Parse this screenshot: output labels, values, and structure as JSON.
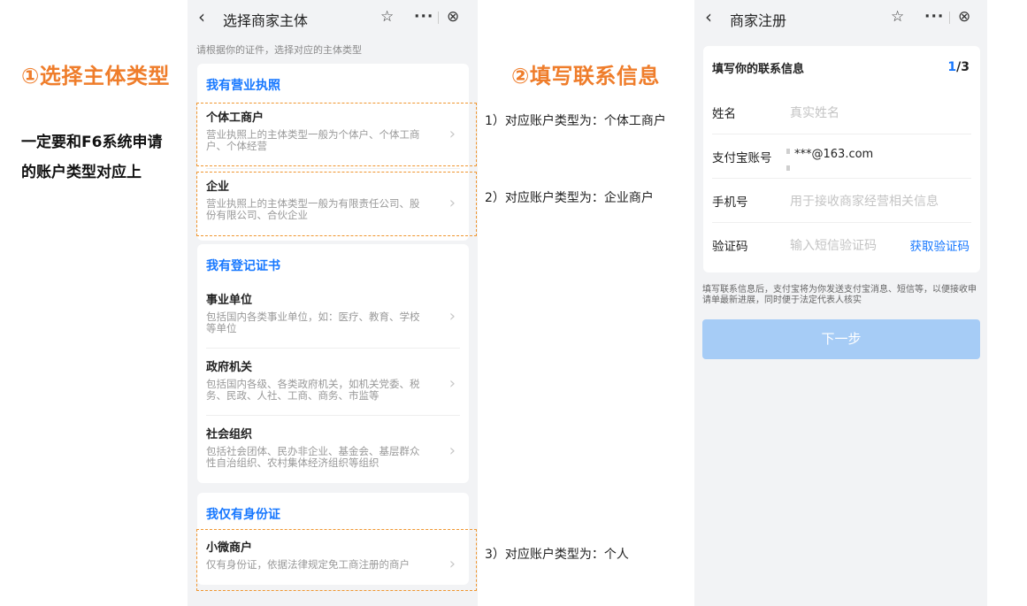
{
  "annotations": {
    "step1_title": "①选择主体类型",
    "step2_title": "②填写联系信息",
    "side_note_line1": "一定要和F6系统申请",
    "side_note_line2": "的账户类型对应上",
    "mapping1": "1）对应账户类型为：个体工商户",
    "mapping2": "2）对应账户类型为：企业商户",
    "mapping3": "3）对应账户类型为：个人"
  },
  "select_page": {
    "title": "选择商家主体",
    "subtitle": "请根据你的证件，选择对应的主体类型",
    "sections": [
      {
        "heading": "我有营业执照",
        "items": [
          {
            "title": "个体工商户",
            "desc": "营业执照上的主体类型一般为个体户、个体工商户、个体经营"
          },
          {
            "title": "企业",
            "desc": "营业执照上的主体类型一般为有限责任公司、股份有限公司、合伙企业"
          }
        ]
      },
      {
        "heading": "我有登记证书",
        "items": [
          {
            "title": "事业单位",
            "desc": "包括国内各类事业单位，如：医疗、教育、学校等单位"
          },
          {
            "title": "政府机关",
            "desc": "包括国内各级、各类政府机关，如机关党委、税务、民政、人社、工商、商务、市监等"
          },
          {
            "title": "社会组织",
            "desc": "包括社会团体、民办非企业、基金会、基层群众性自治组织、农村集体经济组织等组织"
          }
        ]
      },
      {
        "heading": "我仅有身份证",
        "items": [
          {
            "title": "小微商户",
            "desc": "仅有身份证，依据法律规定免工商注册的商户"
          }
        ]
      }
    ]
  },
  "register_page": {
    "title": "商家注册",
    "form_heading": "填写你的联系信息",
    "step_current": "1",
    "step_total": "/3",
    "fields": [
      {
        "label": "姓名",
        "placeholder": "真实姓名"
      },
      {
        "label": "支付宝账号",
        "value": "***@163.com"
      },
      {
        "label": "手机号",
        "placeholder": "用于接收商家经营相关信息"
      },
      {
        "label": "验证码",
        "placeholder": "输入短信验证码",
        "action": "获取验证码"
      }
    ],
    "note": "填写联系信息后，支付宝将为你发送支付宝消息、短信等，以便接收申请单最新进展，同时便于法定代表人核实",
    "next_button": "下一步"
  },
  "colors": {
    "accent_blue": "#1677ff",
    "annotation_orange": "#ef7d2b",
    "disabled_button": "#a6ccf6"
  },
  "icons": [
    "back-arrow-icon",
    "star-icon",
    "more-dots-icon",
    "close-circle-icon",
    "chevron-right-icon"
  ]
}
